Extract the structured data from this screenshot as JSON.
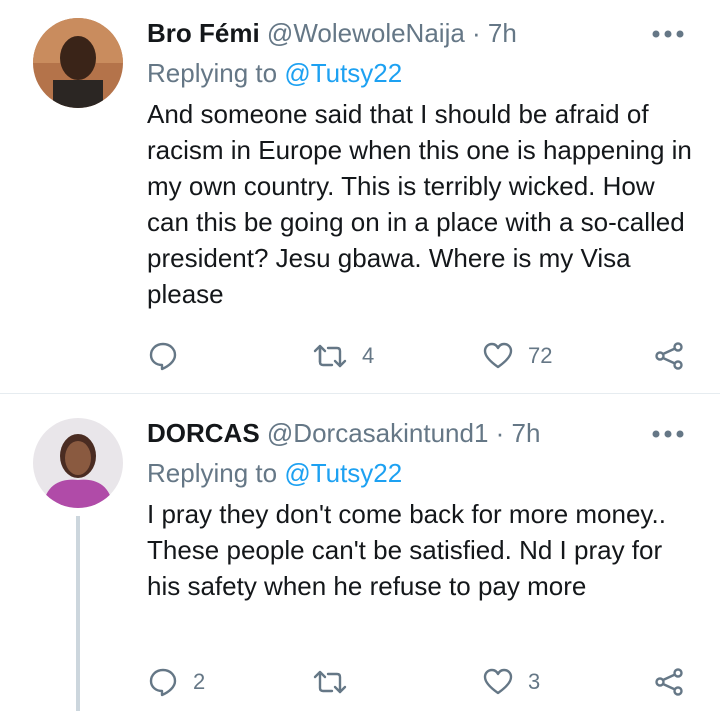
{
  "tweets": [
    {
      "name": "Bro Fémi",
      "handle": "@WolewoleNaija",
      "time": "· 7h",
      "replying_prefix": "Replying to ",
      "replying_to": "@Tutsy22",
      "text": "And someone said that I should be afraid of racism in Europe when this one is happening in my own country. This is terribly wicked. How can this be going on in a place with a so-called president? Jesu gbawa. Where is my Visa please",
      "reply_count": "",
      "retweet_count": "4",
      "like_count": "72",
      "avatar_icon": "user-avatar"
    },
    {
      "name": "DORCAS",
      "handle": "@Dorcasakintund1",
      "time": "· 7h",
      "replying_prefix": "Replying to ",
      "replying_to": "@Tutsy22",
      "text": "I pray they don't come back for more money.. These people can't be satisfied. Nd I pray for his safety when he refuse to pay more",
      "reply_count": "2",
      "retweet_count": "",
      "like_count": "3",
      "avatar_icon": "user-avatar"
    }
  ],
  "colors": {
    "text": "#14171a",
    "muted": "#657786",
    "link": "#1da1f2",
    "divider": "#e6ecf0",
    "thread_line": "#ccd6dd"
  }
}
